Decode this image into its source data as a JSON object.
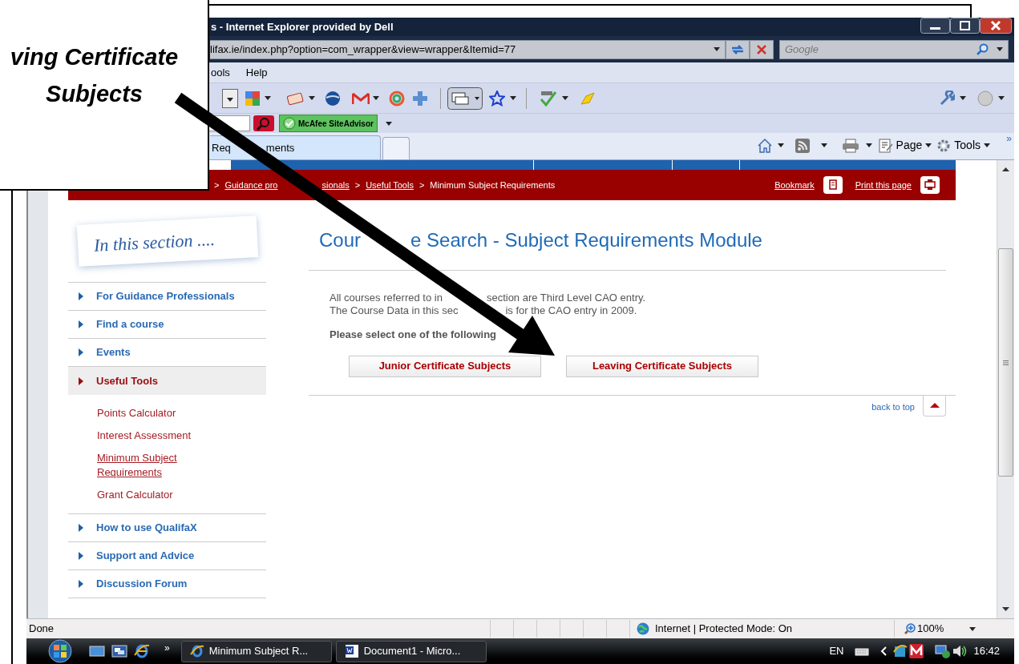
{
  "callout": {
    "lines": [
      "ving Certificate",
      "Subjects"
    ]
  },
  "window": {
    "title": "s - Internet Explorer provided by Dell"
  },
  "address_bar": {
    "url": "lifax.ie/index.php?option=com_wrapper&view=wrapper&Itemid=77"
  },
  "search_box": {
    "placeholder": "Google"
  },
  "menu": [
    "ools",
    "Help"
  ],
  "links_bar": {
    "siteadvisor": "McAfee SiteAdvisor"
  },
  "tabs": [
    {
      "label_parts": [
        "Req",
        "ments"
      ],
      "selected": true
    }
  ],
  "command_bar": {
    "page": "Page",
    "tools": "Tools",
    "overflow": "»"
  },
  "page": {
    "breadcrumb": [
      {
        "separator": ">",
        "label_parts": [
          "Guidance pro",
          "sionals"
        ],
        "link": true
      },
      {
        "separator": ">",
        "label_parts": [
          "Useful Tools"
        ],
        "link": true
      },
      {
        "separator": ">",
        "label_parts": [
          "Minimum Subject Requirements"
        ],
        "link": false
      }
    ],
    "header_links": [
      "Bookmark",
      "Print this page"
    ],
    "sidebar": {
      "heading": "In this section ....",
      "items": [
        {
          "label": "For Guidance Professionals",
          "selected": false
        },
        {
          "label": "Find a course",
          "selected": false
        },
        {
          "label": "Events",
          "selected": false
        },
        {
          "label": "Useful Tools",
          "selected": true,
          "children": [
            {
              "label": "Points Calculator",
              "selected": false
            },
            {
              "label": "Interest Assessment",
              "selected": false
            },
            {
              "label": "Minimum Subject Requirements",
              "selected": true
            },
            {
              "label": "Grant Calculator",
              "selected": false
            }
          ]
        },
        {
          "label": "How to use QualifaX",
          "selected": false
        },
        {
          "label": "Support and Advice",
          "selected": false
        },
        {
          "label": "Discussion Forum",
          "selected": false
        }
      ]
    },
    "title_parts": [
      "Cour",
      "e Search - Subject Requirements Module"
    ],
    "intro": [
      [
        "All courses referred to in",
        "section are Third Level CAO entry."
      ],
      [
        "The Course Data in this sec",
        "is for the CAO entry in 2009."
      ]
    ],
    "prompt": "Please select one of the following",
    "buttons": [
      "Junior Certificate Subjects",
      "Leaving Certificate Subjects"
    ],
    "back_to_top": "back to top"
  },
  "status_bar": {
    "text": "Done",
    "zone": "Internet | Protected Mode: On",
    "zoom": "100%"
  },
  "taskbar": {
    "overflow": "»",
    "tasks": [
      {
        "label": "Minimum Subject R...",
        "kind": "browser"
      },
      {
        "label": "Document1 - Micro...",
        "kind": "word"
      }
    ],
    "language": "EN",
    "clock": "16:42"
  }
}
